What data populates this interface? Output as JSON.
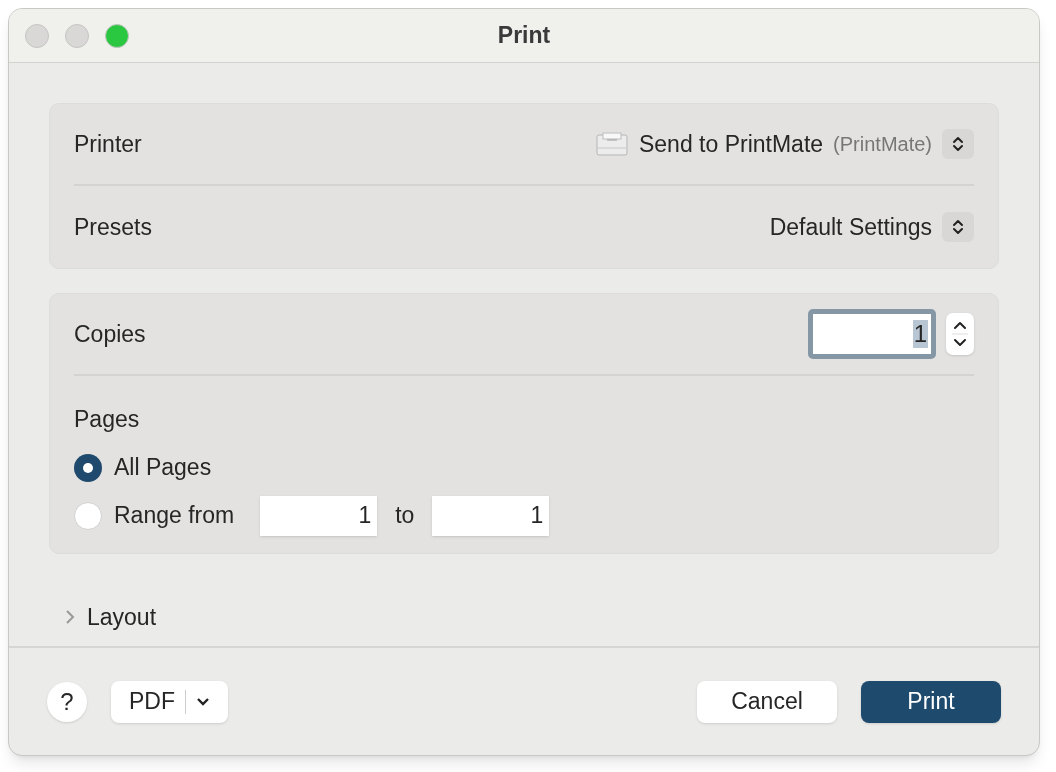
{
  "window": {
    "title": "Print",
    "traffic_lights": [
      {
        "color": "#d9d8d6"
      },
      {
        "color": "#d9d8d6"
      },
      {
        "color": "#2ac840"
      }
    ]
  },
  "printer_section": {
    "rows": [
      {
        "kind": "printer",
        "label": "Printer",
        "value": "Send to PrintMate",
        "secondary": "(PrintMate)"
      },
      {
        "kind": "plain",
        "label": "Presets",
        "value": "Default Settings"
      }
    ]
  },
  "copies": {
    "label": "Copies",
    "value": "1",
    "focused": true
  },
  "pages": {
    "label": "Pages",
    "options": [
      {
        "kind": "all",
        "label": "All Pages",
        "selected": true
      },
      {
        "kind": "range",
        "label": "Range from",
        "selected": false,
        "from": "1",
        "joiner": "to",
        "to": "1"
      }
    ]
  },
  "layout": {
    "label": "Layout",
    "expanded": false
  },
  "footer": {
    "help": "?",
    "pdf": "PDF",
    "cancel": "Cancel",
    "print": "Print"
  }
}
